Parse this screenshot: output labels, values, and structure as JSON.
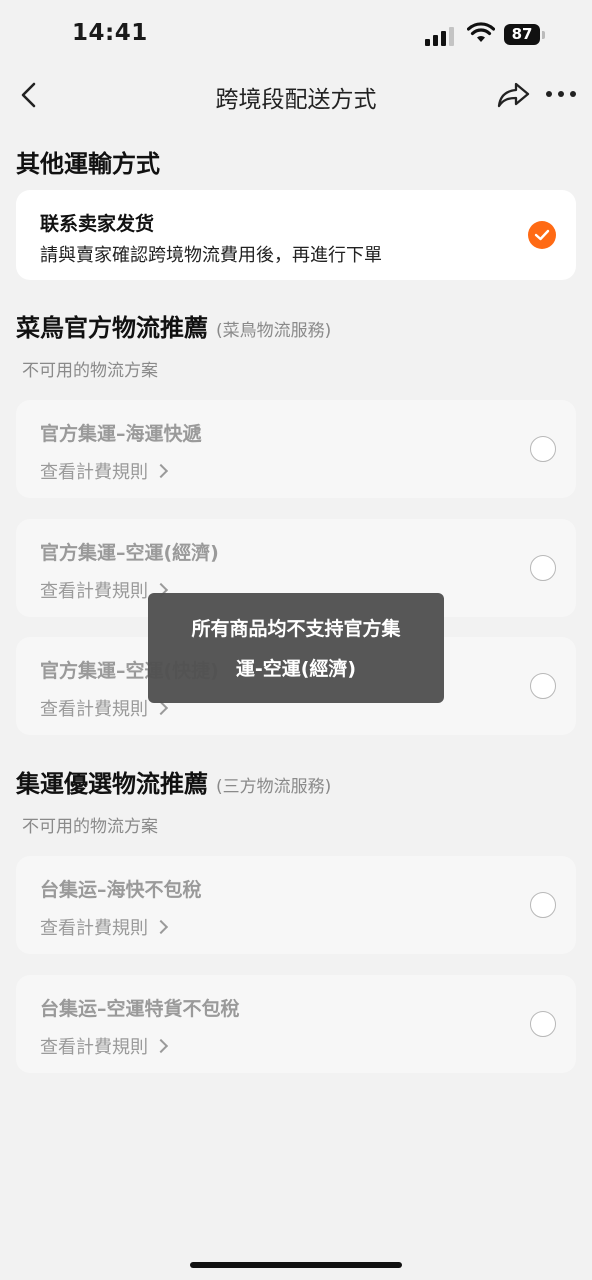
{
  "status_bar": {
    "time": "14:41",
    "battery": "87",
    "icons": [
      "signal-icon",
      "wifi-icon",
      "battery-icon"
    ]
  },
  "nav": {
    "title": "跨境段配送方式",
    "icons": [
      "back-icon",
      "share-icon",
      "more-icon"
    ]
  },
  "other_methods": {
    "title": "其他運輸方式",
    "option": {
      "title": "联系卖家发货",
      "subtitle": "請與賣家確認跨境物流費用後，再進行下單",
      "selected": true
    }
  },
  "cainiao": {
    "title": "菜鳥官方物流推薦",
    "subtitle": "(菜鳥物流服務)",
    "unavailable_label": "不可用的物流方案",
    "options": [
      {
        "title": "官方集運–海運快遞",
        "link": "查看計費規則"
      },
      {
        "title": "官方集運–空運(經濟)",
        "link": "查看計費規則"
      },
      {
        "title": "官方集運–空運(快捷)",
        "link": "查看計費規則"
      }
    ]
  },
  "consolidation": {
    "title": "集運優選物流推薦",
    "subtitle": "(三方物流服務)",
    "unavailable_label": "不可用的物流方案",
    "options": [
      {
        "title": "台集运–海快不包稅",
        "link": "查看計費規則"
      },
      {
        "title": "台集运–空運特貨不包稅",
        "link": "查看計費規則"
      }
    ]
  },
  "toast": {
    "line1": "所有商品均不支持官方集",
    "line2": "運-空運(經濟)"
  },
  "colors": {
    "accent": "#ff6a14",
    "background": "#f2f2f2",
    "disabled_text": "#9a9a9a"
  }
}
